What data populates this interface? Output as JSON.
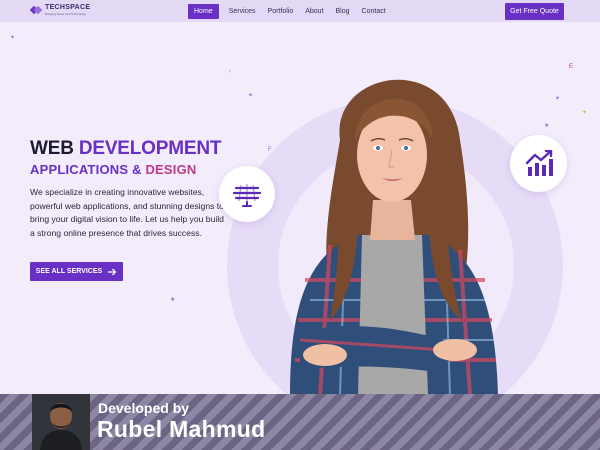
{
  "brand": {
    "name": "TECHSPACE",
    "tagline": "Bridging Ideas and Technology",
    "accent": "#6a2fc4"
  },
  "nav": {
    "items": [
      {
        "label": "Home",
        "active": true
      },
      {
        "label": "Services",
        "active": false
      },
      {
        "label": "Portfolio",
        "active": false
      },
      {
        "label": "About",
        "active": false
      },
      {
        "label": "Blog",
        "active": false
      },
      {
        "label": "Contact",
        "active": false
      }
    ],
    "quote_button": "Get Free Quote"
  },
  "hero": {
    "title_part1": "WEB",
    "title_part2": "DEVELOPMENT",
    "subtitle_part1": "APPLICATIONS &",
    "subtitle_part2": "DESIGN",
    "description": "We specialize in creating innovative websites, powerful web applications, and stunning designs to bring your digital vision to life. Let us help you build a strong online presence that drives success.",
    "cta_label": "SEE ALL SERVICES",
    "cta_icon": "arrow-right-icon"
  },
  "badges": {
    "left_icon": "web-code-icon",
    "right_icon": "bar-chart-growth-icon"
  },
  "developer": {
    "prefix": "Developed by",
    "name": "Rubel Mahmud"
  }
}
